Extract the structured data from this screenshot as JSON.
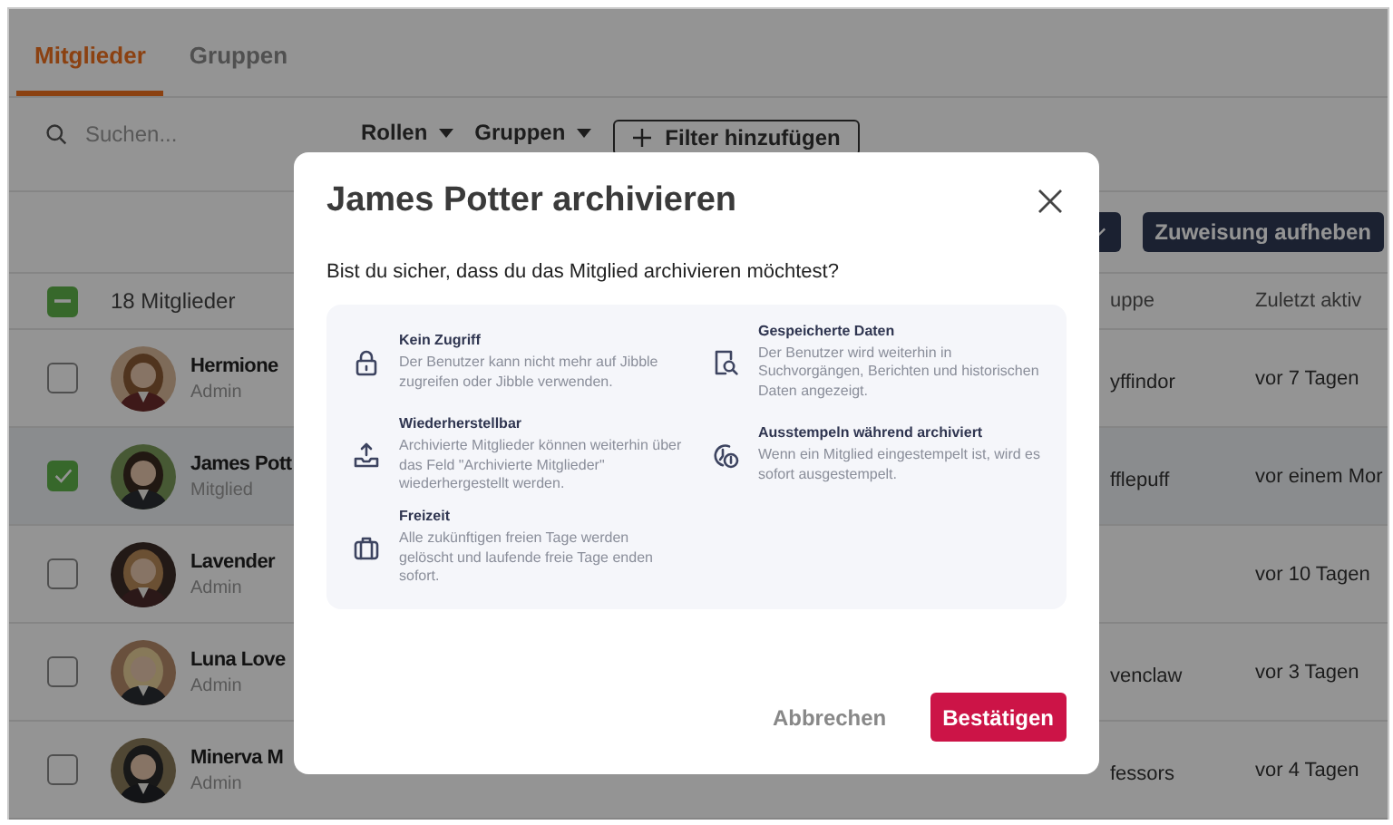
{
  "tabs": [
    {
      "label": "Mitglieder",
      "selected": true
    },
    {
      "label": "Gruppen",
      "selected": false
    }
  ],
  "toolbar": {
    "search": {
      "placeholder": "Suchen..."
    },
    "filters": [
      "Rollen",
      "Gruppen"
    ],
    "add_filter": "Filter hinzufügen"
  },
  "actions": {
    "unassign": "Zuweisung aufheben"
  },
  "table": {
    "select_all": {
      "indeterminate": true
    },
    "count": "18 Mitglieder",
    "columns": [
      "uppe",
      "Zuletzt aktiv"
    ],
    "rows": [
      {
        "name": "Hermione",
        "role": "Admin",
        "group": "yffindor",
        "last_active": "vor 7 Tagen",
        "selected": false
      },
      {
        "name": "James Pott",
        "role": "Mitglied",
        "group": "fflepuff",
        "last_active": "vor einem Mor",
        "selected": true
      },
      {
        "name": "Lavender",
        "role": "Admin",
        "last_active": "vor 10 Tagen",
        "selected": false
      },
      {
        "name": "Luna Love",
        "role": "Admin",
        "group": "venclaw",
        "last_active": "vor 3 Tagen",
        "selected": false
      },
      {
        "name": "Minerva M",
        "role": "Admin",
        "group": "fessors",
        "last_active": "vor 4 Tagen",
        "selected": false
      }
    ]
  },
  "modal": {
    "title": "James Potter archivieren",
    "question": "Bist du sicher, dass du das Mitglied archivieren möchtest?",
    "items": [
      {
        "kind": "lock",
        "title": "Kein Zugriff",
        "text": "Der Benutzer kann nicht mehr auf Jibble zugreifen oder Jibble verwenden."
      },
      {
        "kind": "search-doc",
        "title": "Gespeicherte Daten",
        "text": "Der Benutzer wird weiterhin in Suchvorgängen, Berichten und historischen Daten angezeigt."
      },
      {
        "kind": "upload",
        "title": "Wiederherstellbar",
        "text": "Archivierte Mitglieder können weiterhin über das Feld \"Archivierte Mitglieder\" wiederhergestellt werden."
      },
      {
        "kind": "clock",
        "title": "Ausstempeln während archiviert",
        "text": "Wenn ein Mitglied eingestempelt ist, wird es sofort ausgestempelt."
      },
      {
        "kind": "suitcase",
        "title": "Freizeit",
        "text": "Alle zukünftigen freien Tage werden gelöscht und laufende freie Tage enden sofort."
      }
    ],
    "cancel": "Abbrechen",
    "confirm": "Bestätigen"
  }
}
